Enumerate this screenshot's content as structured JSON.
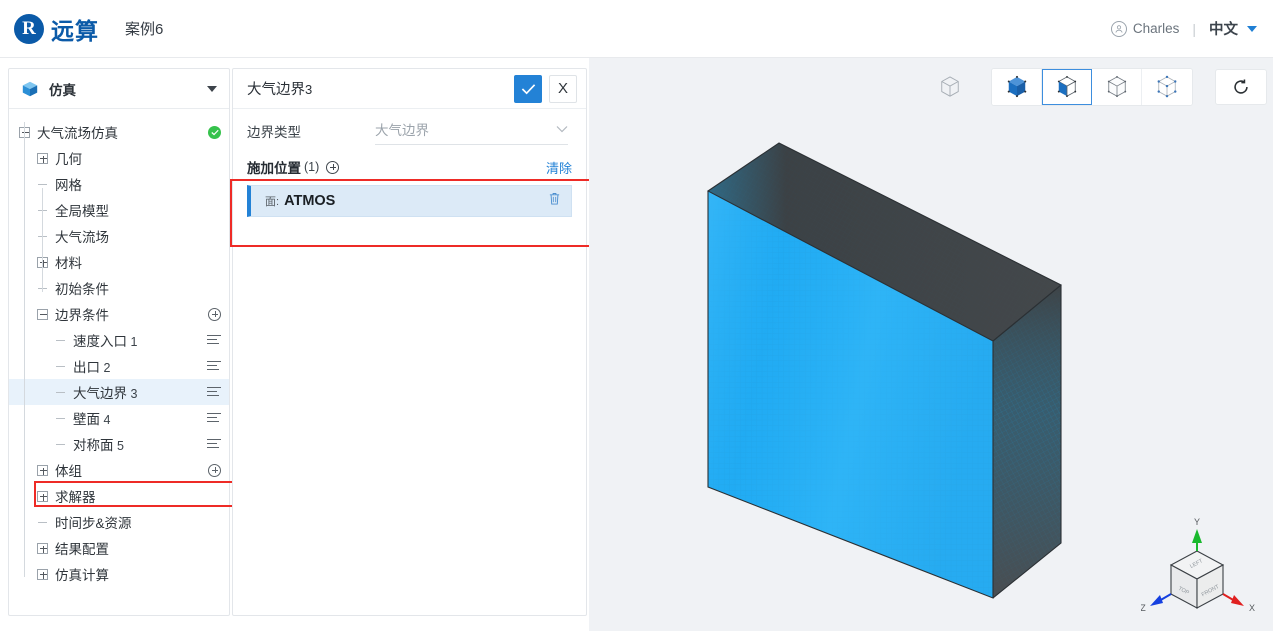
{
  "header": {
    "logo_glyph": "R",
    "logo_text": "远算",
    "project_title": "案例6",
    "user_name": "Charles",
    "divider": "|",
    "language": "中文",
    "avatar_icon": "user-circle-icon",
    "caret_icon": "caret-down-icon"
  },
  "sidebar": {
    "icon": "cube-icon",
    "title": "仿真",
    "collapse_icon": "caret-down-icon",
    "tree": [
      {
        "label": "大气流场仿真",
        "indent": 0,
        "toggle": "minus",
        "badge": "check",
        "selected": false
      },
      {
        "label": "几何",
        "indent": 1,
        "toggle": "plus",
        "badge": "none",
        "selected": false
      },
      {
        "label": "网格",
        "indent": 1,
        "toggle": "leaf",
        "badge": "none",
        "selected": false
      },
      {
        "label": "全局模型",
        "indent": 1,
        "toggle": "leaf",
        "badge": "none",
        "selected": false
      },
      {
        "label": "大气流场",
        "indent": 1,
        "toggle": "leaf",
        "badge": "none",
        "selected": false
      },
      {
        "label": "材料",
        "indent": 1,
        "toggle": "plus",
        "badge": "none",
        "selected": false
      },
      {
        "label": "初始条件",
        "indent": 1,
        "toggle": "leaf",
        "badge": "none",
        "selected": false
      },
      {
        "label": "边界条件",
        "indent": 1,
        "toggle": "minus",
        "badge": "plus",
        "selected": false
      },
      {
        "label": "速度入口",
        "num": "1",
        "indent": 2,
        "toggle": "leaf",
        "badge": "menu",
        "selected": false
      },
      {
        "label": "出口",
        "num": "2",
        "indent": 2,
        "toggle": "leaf",
        "badge": "menu",
        "selected": false
      },
      {
        "label": "大气边界",
        "num": "3",
        "indent": 2,
        "toggle": "leaf",
        "badge": "menu",
        "selected": true
      },
      {
        "label": "壁面",
        "num": "4",
        "indent": 2,
        "toggle": "leaf",
        "badge": "menu",
        "selected": false
      },
      {
        "label": "对称面",
        "num": "5",
        "indent": 2,
        "toggle": "leaf",
        "badge": "menu",
        "selected": false
      },
      {
        "label": "体组",
        "indent": 1,
        "toggle": "plus",
        "badge": "plus",
        "selected": false
      },
      {
        "label": "求解器",
        "indent": 1,
        "toggle": "plus",
        "badge": "none",
        "selected": false
      },
      {
        "label": "时间步&资源",
        "indent": 1,
        "toggle": "leaf",
        "badge": "none",
        "selected": false
      },
      {
        "label": "结果配置",
        "indent": 1,
        "toggle": "plus",
        "badge": "none",
        "selected": false
      },
      {
        "label": "仿真计算",
        "indent": 1,
        "toggle": "plus",
        "badge": "none",
        "selected": false
      }
    ]
  },
  "panel": {
    "title": "大气边界",
    "title_num": "3",
    "confirm_icon": "check-icon",
    "cancel_icon": "close-icon",
    "cancel_label": "X",
    "boundary_type_label": "边界类型",
    "boundary_type_value": "大气边界",
    "dropdown_icon": "chevron-down-icon",
    "apply_location_label": "施加位置",
    "apply_location_count": "(1)",
    "add_icon": "plus-circle-icon",
    "clear_label": "清除",
    "items": [
      {
        "prefix": "面:",
        "name": "ATMOS",
        "delete_icon": "trash-icon"
      }
    ]
  },
  "viewport": {
    "toolbar": [
      {
        "name": "wireframe-cube-icon",
        "active": false,
        "standalone": true
      },
      {
        "name": "solid-cube-icon",
        "active": false,
        "standalone": false
      },
      {
        "name": "solid-edges-cube-icon",
        "active": true,
        "standalone": false
      },
      {
        "name": "outline-cube-icon",
        "active": false,
        "standalone": false
      },
      {
        "name": "points-cube-icon",
        "active": false,
        "standalone": false
      },
      {
        "name": "reset-view-icon",
        "active": false,
        "standalone": true
      }
    ],
    "axis": {
      "x_label": "X",
      "y_label": "Y",
      "z_label": "Z",
      "face_top": "TOP",
      "face_left": "LEFT",
      "face_front": "FRONT",
      "x_color": "#e02020",
      "y_color": "#19b92d",
      "z_color": "#1540e0"
    },
    "model": {
      "front_face_color": "#29b0f5",
      "side_face_color": "#4a4d50",
      "top_face_color": "#3f4346",
      "background_color": "#f0f2f5",
      "mesh_line_color": "#2aa2e0"
    }
  },
  "colors": {
    "brand": "#0b5aa8",
    "accent": "#2382d6",
    "success": "#36c24c",
    "highlight_box": "#ee2b26",
    "selection_bg": "#e8f2fb"
  }
}
